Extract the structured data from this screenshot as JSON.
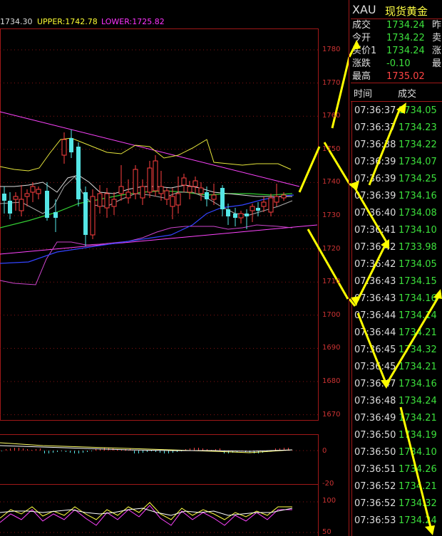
{
  "indicator": {
    "mid": "1734.30",
    "upper": "UPPER:1742.78",
    "lower": "LOWER:1725.82"
  },
  "price_axis": [
    "1780",
    "1770",
    "1760",
    "1750",
    "1740",
    "1730",
    "1720",
    "1710",
    "1700",
    "1690",
    "1680",
    "1670"
  ],
  "macd_axis": [
    "0",
    "-20"
  ],
  "kdj_axis": [
    "100",
    "50"
  ],
  "header": {
    "symbol": "XAU",
    "name": "现货黄金"
  },
  "quote": [
    {
      "label": "成交",
      "value": "1734.24",
      "color": "#3ce03c",
      "right": "昨"
    },
    {
      "label": "今开",
      "value": "1734.22",
      "color": "#3ce03c",
      "right": "卖"
    },
    {
      "label": "买价1",
      "value": "1734.24",
      "color": "#3ce03c",
      "right": "涨"
    },
    {
      "label": "涨跌",
      "value": "-0.10",
      "color": "#3ce03c",
      "right": "最"
    },
    {
      "label": "最高",
      "value": "1735.02",
      "color": "#ff4444",
      "right": ""
    }
  ],
  "ticks_header": {
    "time": "时间",
    "price": "成交"
  },
  "ticks": [
    {
      "time": "07:36:37",
      "price": "1734.05"
    },
    {
      "time": "07:36:37",
      "price": "1734.23"
    },
    {
      "time": "07:36:38",
      "price": "1734.22"
    },
    {
      "time": "07:36:39",
      "price": "1734.07"
    },
    {
      "time": "07:36:39",
      "price": "1734.25"
    },
    {
      "time": "07:36:39",
      "price": "1734.16"
    },
    {
      "time": "07:36:40",
      "price": "1734.08"
    },
    {
      "time": "07:36:41",
      "price": "1734.10"
    },
    {
      "time": "07:36:42",
      "price": "1733.98"
    },
    {
      "time": "07:36:42",
      "price": "1734.05"
    },
    {
      "time": "07:36:43",
      "price": "1734.15"
    },
    {
      "time": "07:36:43",
      "price": "1734.16"
    },
    {
      "time": "07:36:44",
      "price": "1734.14"
    },
    {
      "time": "07:36:44",
      "price": "1734.21"
    },
    {
      "time": "07:36:45",
      "price": "1734.32"
    },
    {
      "time": "07:36:45",
      "price": "1734.21"
    },
    {
      "time": "07:36:47",
      "price": "1734.16"
    },
    {
      "time": "07:36:48",
      "price": "1734.24"
    },
    {
      "time": "07:36:49",
      "price": "1734.21"
    },
    {
      "time": "07:36:50",
      "price": "1734.19"
    },
    {
      "time": "07:36:50",
      "price": "1734.10"
    },
    {
      "time": "07:36:51",
      "price": "1734.26"
    },
    {
      "time": "07:36:52",
      "price": "1734.21"
    },
    {
      "time": "07:36:52",
      "price": "1734.32"
    },
    {
      "time": "07:36:53",
      "price": "1734.24"
    }
  ]
}
